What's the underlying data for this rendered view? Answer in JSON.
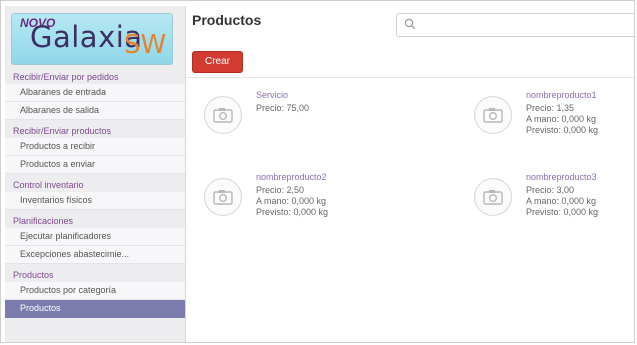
{
  "logo": {
    "text_novo": "NOVO",
    "text_galaxia": "Galaxia",
    "text_sw": "SW"
  },
  "sidebar": {
    "sections": [
      {
        "title": "Recibir/Enviar por pedidos",
        "items": [
          "Albaranes de entrada",
          "Albaranes de salida"
        ]
      },
      {
        "title": "Recibir/Enviar productos",
        "items": [
          "Productos a recibir",
          "Productos a enviar"
        ]
      },
      {
        "title": "Control inventario",
        "items": [
          "Inventarios físicos"
        ]
      },
      {
        "title": "Planificaciones",
        "items": [
          "Ejecutar planificadores",
          "Excepciones abastecimie..."
        ]
      },
      {
        "title": "Productos",
        "items": [
          "Productos por categoría",
          "Productos"
        ]
      }
    ],
    "active_item": "Productos"
  },
  "main": {
    "title": "Productos",
    "search_placeholder": "",
    "create_label": "Crear",
    "products": [
      {
        "name": "Servicio",
        "lines": [
          "Precio: 75,00"
        ]
      },
      {
        "name": "nombreproducto1",
        "lines": [
          "Precio: 1,35",
          "A mano: 0,000 kg",
          "Previsto: 0,000 kg"
        ]
      },
      {
        "name": "nombreproducto2",
        "lines": [
          "Precio: 2,50",
          "A mano: 0,000 kg",
          "Previsto: 0,000 kg"
        ]
      },
      {
        "name": "nombreproducto3",
        "lines": [
          "Precio: 3,00",
          "A mano: 0,000 kg",
          "Previsto: 0,000 kg"
        ]
      }
    ]
  },
  "colors": {
    "accent": "#d23b31",
    "active_menu": "#7c7bad",
    "section_title": "#7d4a8e",
    "product_name": "#8a6fb0"
  }
}
